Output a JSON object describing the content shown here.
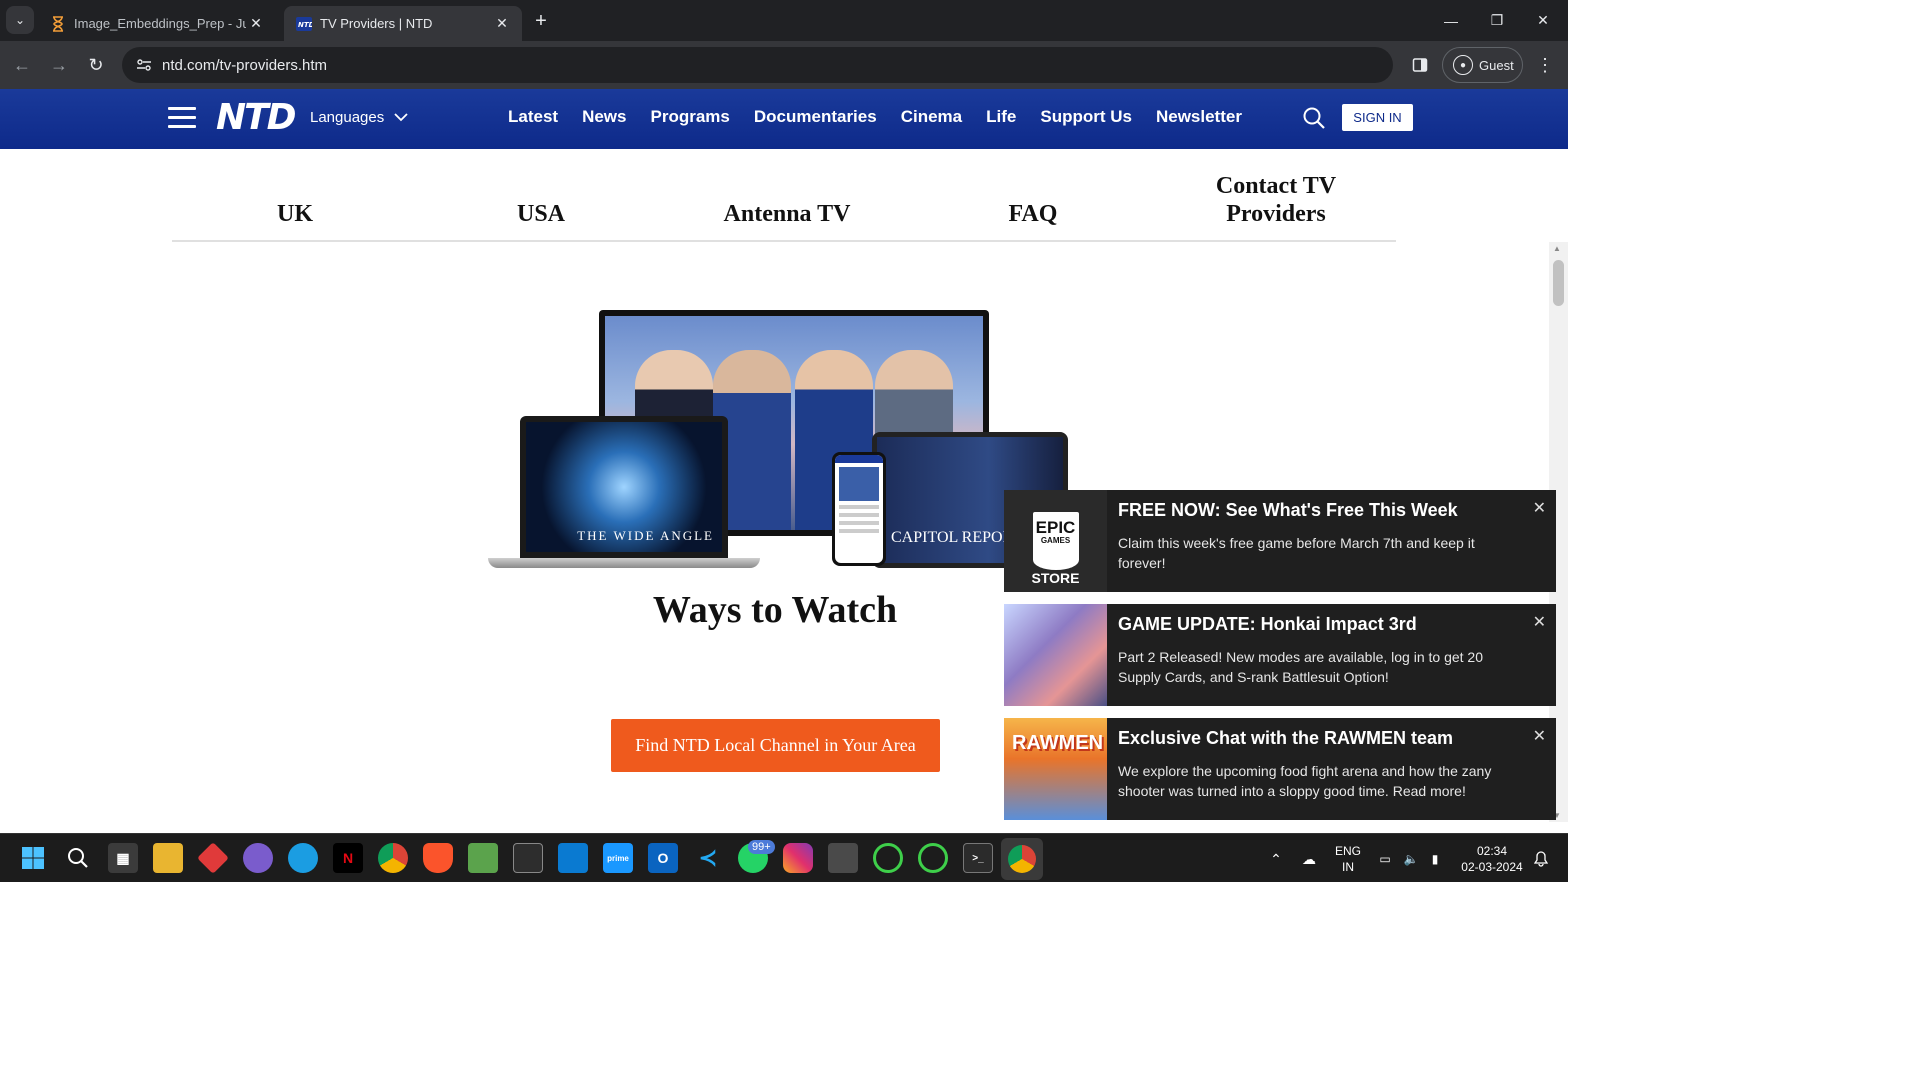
{
  "browser": {
    "tabs": [
      {
        "title": "Image_Embeddings_Prep - Jupy",
        "favicon": "hourglass-icon",
        "active": false
      },
      {
        "title": "TV Providers | NTD",
        "favicon": "ntd-favicon",
        "active": true
      }
    ],
    "url": "ntd.com/tv-providers.htm",
    "profile_label": "Guest"
  },
  "site": {
    "logo": "NTD",
    "languages_label": "Languages",
    "nav": [
      "Latest",
      "News",
      "Programs",
      "Documentaries",
      "Cinema",
      "Life",
      "Support Us",
      "Newsletter"
    ],
    "sign_in_label": "SIGN IN",
    "brand_color": "#0e2a8a"
  },
  "subnav": [
    "UK",
    "USA",
    "Antenna TV",
    "FAQ",
    "Contact TV Providers"
  ],
  "hero": {
    "laptop_caption": "THE WIDE ANGLE",
    "tablet_caption": "CAPITOL REPORT",
    "heading": "Ways to Watch",
    "cta_label": "Find NTD Local Channel in Your Area",
    "cta_color": "#ef5a1d"
  },
  "notifications": [
    {
      "title": "FREE NOW: See What's Free This Week",
      "text": "Claim this week's free game before March 7th and keep it forever!",
      "thumb": "epic-games-store",
      "thumb_text": "EPIC",
      "thumb_sub": "GAMES",
      "thumb_store": "STORE"
    },
    {
      "title": "GAME UPDATE: Honkai Impact 3rd",
      "text": "Part 2 Released! New modes are available, log in to get 20 Supply Cards, and S-rank Battlesuit Option!",
      "thumb": "honkai-impact"
    },
    {
      "title": "Exclusive Chat with the RAWMEN team",
      "text": "We explore the upcoming food fight arena and how the zany shooter was turned into a sloppy good time. Read more!",
      "thumb": "rawmen",
      "thumb_text": "RAWMEN"
    }
  ],
  "taskbar": {
    "badge": "99+",
    "lang_line1": "ENG",
    "lang_line2": "IN",
    "time": "02:34",
    "date": "02-03-2024"
  }
}
